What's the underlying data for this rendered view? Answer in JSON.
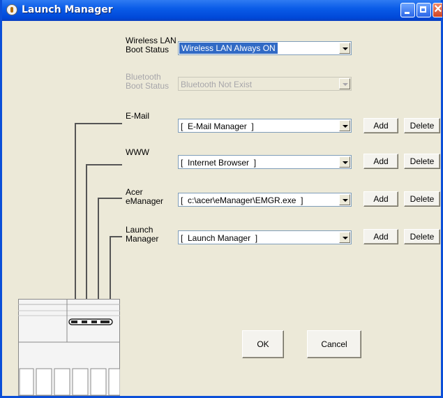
{
  "window": {
    "title": "Launch Manager"
  },
  "wireless": {
    "label_line1": "Wireless LAN",
    "label_line2": "Boot Status",
    "value": "Wireless LAN Always ON"
  },
  "bluetooth": {
    "label_line1": "Bluetooth",
    "label_line2": "Boot Status",
    "value": "Bluetooth Not Exist"
  },
  "rows": [
    {
      "label_line1": "E-Mail",
      "label_line2": "",
      "value": "[  E-Mail Manager  ]",
      "add": "Add",
      "delete": "Delete"
    },
    {
      "label_line1": "WWW",
      "label_line2": "",
      "value": "[  Internet Browser  ]",
      "add": "Add",
      "delete": "Delete"
    },
    {
      "label_line1": "Acer",
      "label_line2": "eManager",
      "value": "[  c:\\acer\\eManager\\EMGR.exe  ]",
      "add": "Add",
      "delete": "Delete"
    },
    {
      "label_line1": "Launch",
      "label_line2": "Manager",
      "value": "[  Launch Manager  ]",
      "add": "Add",
      "delete": "Delete"
    }
  ],
  "footer": {
    "ok": "OK",
    "cancel": "Cancel"
  },
  "icons": [
    "app-icon",
    "minimize-icon",
    "maximize-icon",
    "close-icon",
    "dropdown-arrow-icon",
    "keyboard-illustration"
  ]
}
